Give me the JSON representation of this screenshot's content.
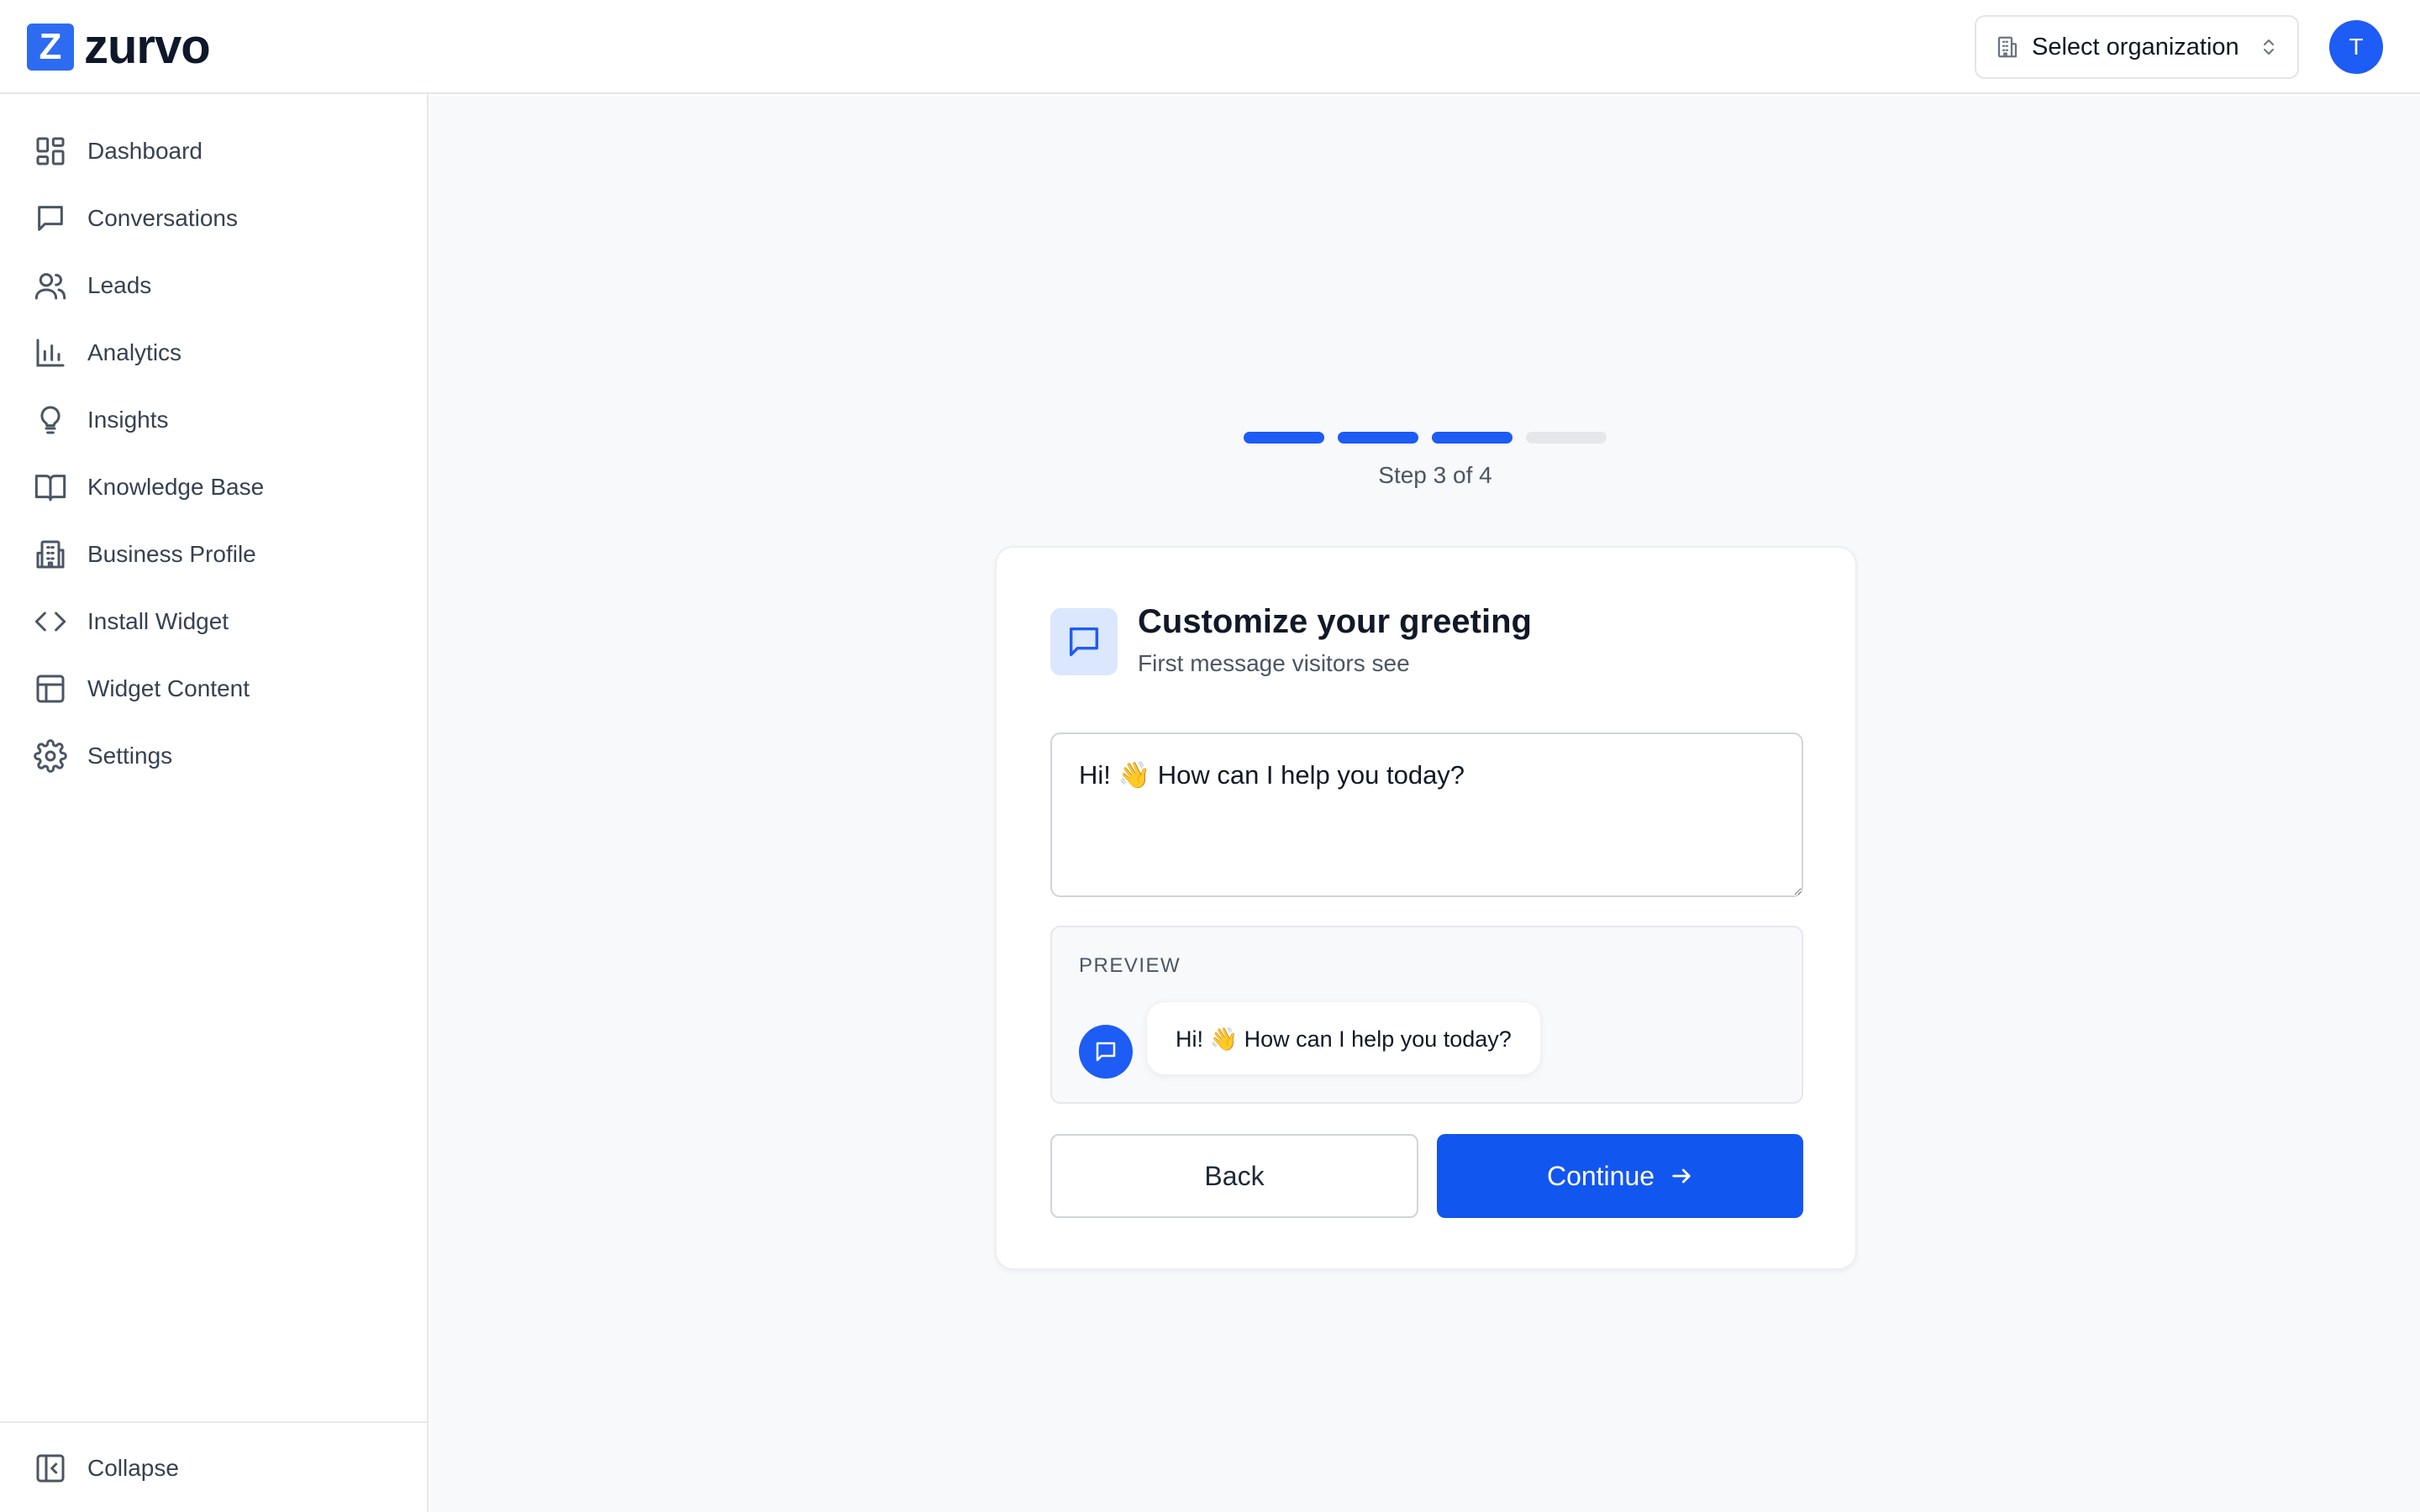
{
  "app": {
    "logo_mark": "Z",
    "name": "zurvo"
  },
  "header": {
    "org_select_label": "Select organization",
    "org_icon": "building-icon",
    "avatar_initial": "T"
  },
  "sidebar": {
    "items": [
      {
        "label": "Dashboard",
        "icon": "dashboard-grid-icon"
      },
      {
        "label": "Conversations",
        "icon": "chat-bubble-icon"
      },
      {
        "label": "Leads",
        "icon": "users-icon"
      },
      {
        "label": "Analytics",
        "icon": "bar-chart-icon"
      },
      {
        "label": "Insights",
        "icon": "lightbulb-icon"
      },
      {
        "label": "Knowledge Base",
        "icon": "book-open-icon"
      },
      {
        "label": "Business Profile",
        "icon": "building-icon"
      },
      {
        "label": "Install Widget",
        "icon": "code-icon"
      },
      {
        "label": "Widget Content",
        "icon": "layout-icon"
      },
      {
        "label": "Settings",
        "icon": "gear-icon"
      }
    ],
    "collapse_label": "Collapse",
    "collapse_icon": "panel-collapse-icon"
  },
  "wizard": {
    "step_current": 3,
    "step_total": 4,
    "step_label": "Step 3 of 4",
    "title": "Customize your greeting",
    "subtitle": "First message visitors see",
    "greeting_value": "Hi! 👋 How can I help you today?",
    "preview_label": "PREVIEW",
    "preview_message": "Hi! 👋 How can I help you today?",
    "back_label": "Back",
    "continue_label": "Continue"
  },
  "colors": {
    "accent": "#1256f0",
    "progress_done": "#1d5cf5",
    "progress_todo": "#e5e7eb",
    "icon_tile_bg": "#dbe7fd",
    "main_bg": "#f8f9fb"
  }
}
